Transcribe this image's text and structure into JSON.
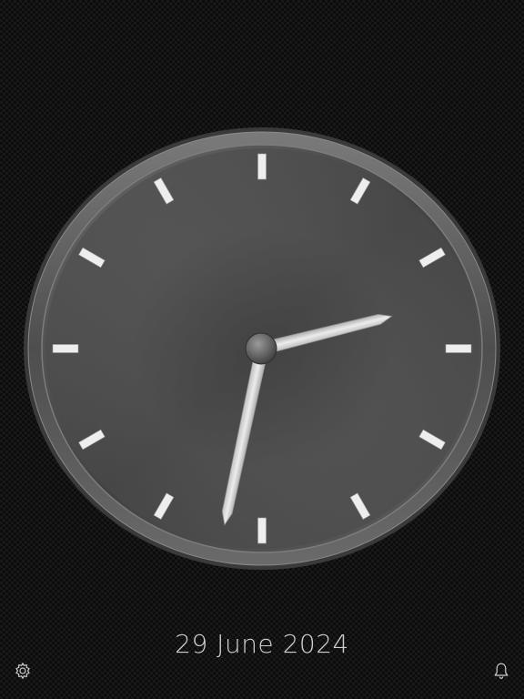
{
  "date": "29 June 2024",
  "time": {
    "hour": 2,
    "minute": 32
  },
  "icons": {
    "settings": "gear-icon",
    "alarm": "bell-icon"
  },
  "colors": {
    "background": "#0c0c0c",
    "face": "#5a5a5a",
    "bezel": "#6e6e6e",
    "hand": "#d9d9d9",
    "text": "#cfcfcf"
  }
}
